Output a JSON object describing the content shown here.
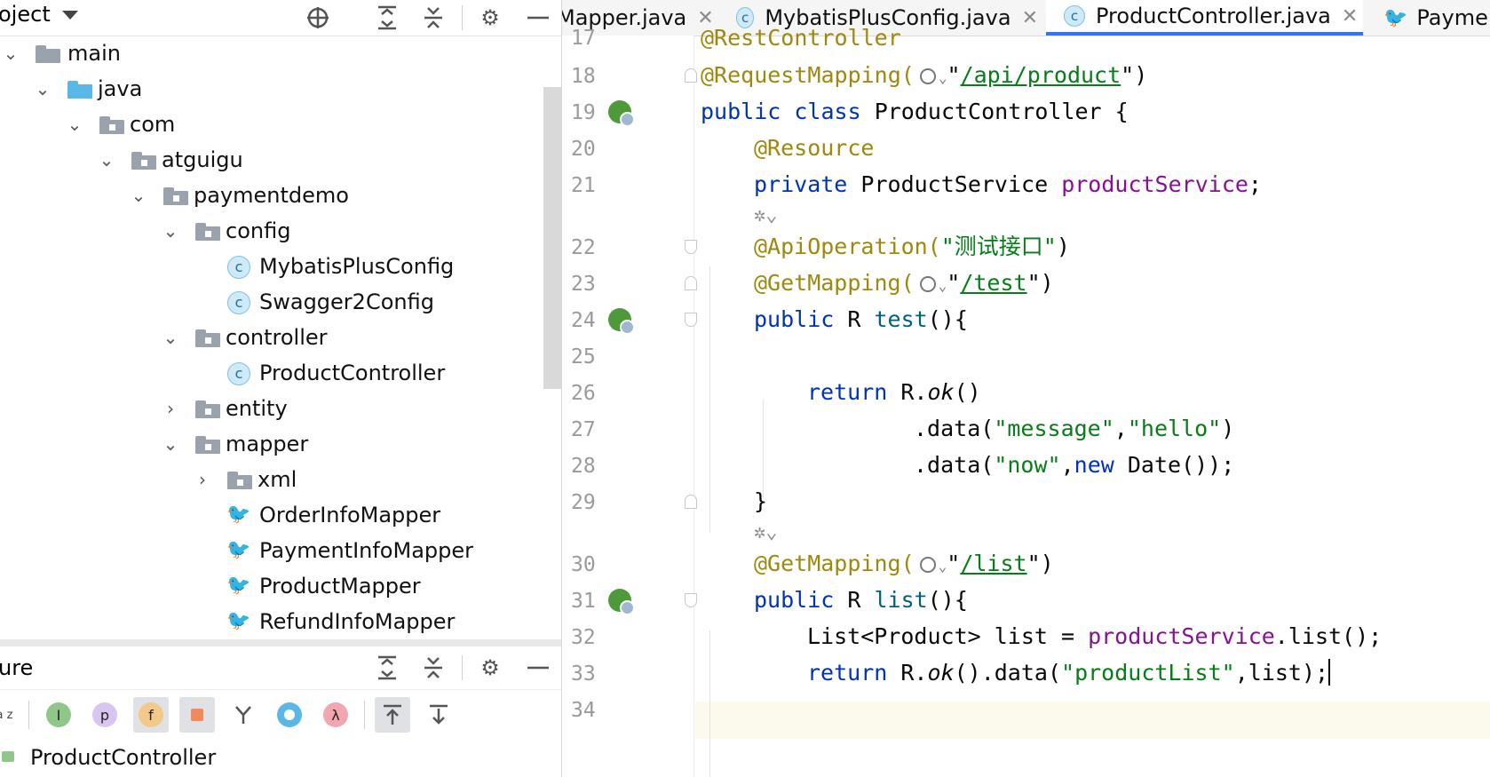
{
  "project_pane": {
    "title": "oject",
    "tree": [
      {
        "label": "main",
        "type": "folder",
        "expanded": true
      },
      {
        "label": "java",
        "type": "source-folder",
        "expanded": true
      },
      {
        "label": "com",
        "type": "package",
        "expanded": true
      },
      {
        "label": "atguigu",
        "type": "package",
        "expanded": true
      },
      {
        "label": "paymentdemo",
        "type": "package",
        "expanded": true
      },
      {
        "label": "config",
        "type": "package",
        "expanded": true
      },
      {
        "label": "MybatisPlusConfig",
        "type": "class"
      },
      {
        "label": "Swagger2Config",
        "type": "class"
      },
      {
        "label": "controller",
        "type": "package",
        "expanded": true
      },
      {
        "label": "ProductController",
        "type": "class"
      },
      {
        "label": "entity",
        "type": "package",
        "expanded": false
      },
      {
        "label": "mapper",
        "type": "package",
        "expanded": true
      },
      {
        "label": "xml",
        "type": "package",
        "expanded": false
      },
      {
        "label": "OrderInfoMapper",
        "type": "mapper"
      },
      {
        "label": "PaymentInfoMapper",
        "type": "mapper"
      },
      {
        "label": "ProductMapper",
        "type": "mapper"
      },
      {
        "label": "RefundInfoMapper",
        "type": "mapper"
      }
    ]
  },
  "structure_pane": {
    "title": "ure",
    "item": "ProductController",
    "toolbar_letters": {
      "sort": "a z",
      "inherited": "I",
      "properties": "p",
      "fields": "f",
      "lambda": "λ"
    }
  },
  "editor": {
    "tabs": [
      {
        "label": "Mapper.java",
        "active": false
      },
      {
        "label": "MybatisPlusConfig.java",
        "active": false
      },
      {
        "label": "ProductController.java",
        "active": true
      },
      {
        "label": "Paymen",
        "active": false
      }
    ],
    "code": {
      "l17": {
        "ln": "17",
        "ann": "@RestController"
      },
      "l18": {
        "ln": "18",
        "ann": "@RequestMapping(",
        "url": "/api/product",
        "end": "\")"
      },
      "l19": {
        "ln": "19",
        "kw1": "public",
        "kw2": "class",
        "name": "ProductController {"
      },
      "l20": {
        "ln": "20",
        "ann": "@Resource"
      },
      "l21": {
        "ln": "21",
        "kw": "private",
        "type": "ProductService",
        "field": "productService",
        "end": ";"
      },
      "l22": {
        "ln": "22",
        "ann": "@ApiOperation(",
        "str": "\"测试接口\"",
        "end": ")"
      },
      "l23": {
        "ln": "23",
        "ann": "@GetMapping(",
        "url": "/test",
        "end": "\")"
      },
      "l24": {
        "ln": "24",
        "kw": "public",
        "type": "R",
        "method": "test",
        "end": "(){"
      },
      "l25": {
        "ln": "25"
      },
      "l26": {
        "ln": "26",
        "kw": "return",
        "pre": "R.",
        "call": "ok",
        "end": "()"
      },
      "l27": {
        "ln": "27",
        "pre": ".data(",
        "s1": "\"message\"",
        "sep": ",",
        "s2": "\"hello\"",
        "end": ")"
      },
      "l28": {
        "ln": "28",
        "pre": ".data(",
        "s1": "\"now\"",
        "sep": ",",
        "kw": "new",
        "end": "Date());"
      },
      "l29": {
        "ln": "29",
        "text": "}"
      },
      "l30": {
        "ln": "30",
        "ann": "@GetMapping(",
        "url": "/list",
        "end": "\")"
      },
      "l31": {
        "ln": "31",
        "kw": "public",
        "type": "R",
        "method": "list",
        "end": "(){"
      },
      "l32": {
        "ln": "32",
        "pre": "List<Product> list = ",
        "field": "productService",
        "end": ".list();"
      },
      "l33": {
        "ln": "33",
        "kw": "return",
        "pre": "R.",
        "call": "ok",
        "mid": "().data(",
        "str": "\"productList\"",
        "end": ",list);"
      },
      "l34": {
        "ln": "34"
      }
    }
  }
}
